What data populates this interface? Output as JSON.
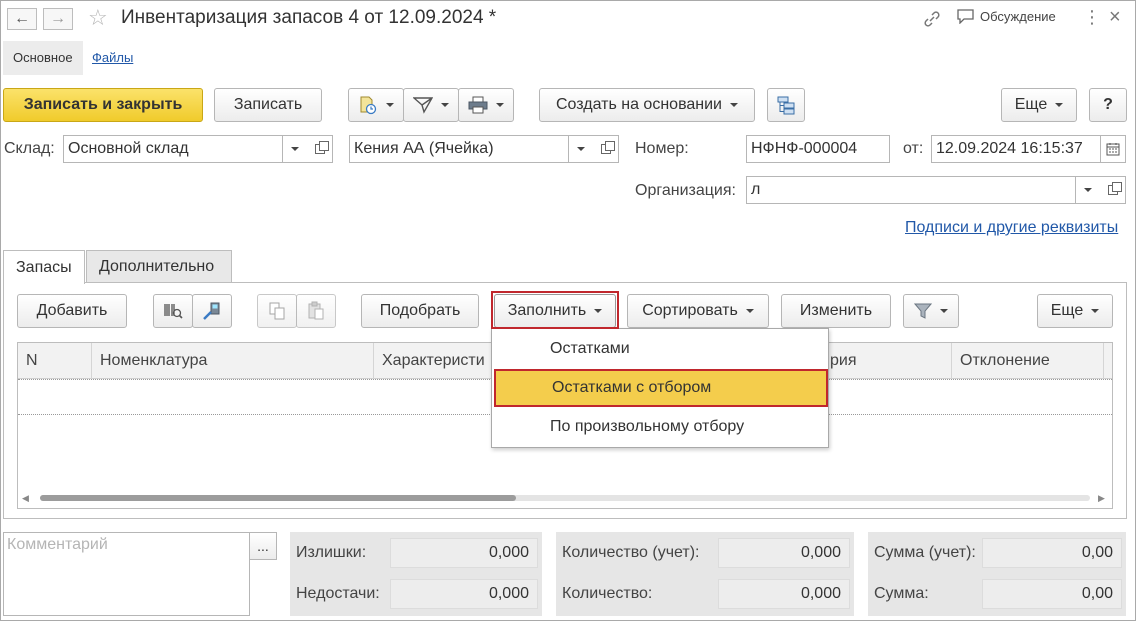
{
  "window": {
    "title": "Инвентаризация запасов 4 от 12.09.2024 *",
    "discussion_label": "Обсуждение"
  },
  "top_tabs": [
    "Основное",
    "Файлы"
  ],
  "toolbar": {
    "save_close": "Записать и закрыть",
    "save": "Записать",
    "create_based": "Создать на основании",
    "more": "Еще",
    "help": "?"
  },
  "form": {
    "warehouse_label": "Склад:",
    "warehouse_value": "Основной склад",
    "cell_value": "Кения АА (Ячейка)",
    "number_label": "Номер:",
    "number_value": "НФНФ-000004",
    "date_label": "от:",
    "date_value": "12.09.2024 16:15:37",
    "org_label": "Организация:",
    "org_value": "л",
    "signatures_link": "Подписи и другие реквизиты"
  },
  "tabs": [
    "Запасы",
    "Дополнительно"
  ],
  "table_toolbar": {
    "add": "Добавить",
    "pick": "Подобрать",
    "fill": "Заполнить",
    "sort": "Сортировать",
    "change": "Изменить",
    "more": "Еще"
  },
  "table": {
    "columns": [
      "N",
      "Номенклатура",
      "Характеристи",
      "рия",
      "Отклонение"
    ]
  },
  "fill_menu": {
    "items": [
      "Остатками",
      "Остатками с отбором",
      "По произвольному отбору"
    ],
    "highlighted_index": 1
  },
  "footer": {
    "comment_placeholder": "Комментарий",
    "comment_btn": "...",
    "surplus_label": "Излишки:",
    "surplus_value": "0,000",
    "shortage_label": "Недостачи:",
    "shortage_value": "0,000",
    "qty_acc_label": "Количество (учет):",
    "qty_acc_value": "0,000",
    "qty_label": "Количество:",
    "qty_value": "0,000",
    "sum_acc_label": "Сумма (учет):",
    "sum_acc_value": "0,00",
    "sum_label": "Сумма:",
    "sum_value": "0,00"
  },
  "colors": {
    "primary_button": "#f0cb2b",
    "highlight_menu": "#f4cd4c",
    "highlight_border": "#c0272d",
    "link": "#2158a8"
  }
}
